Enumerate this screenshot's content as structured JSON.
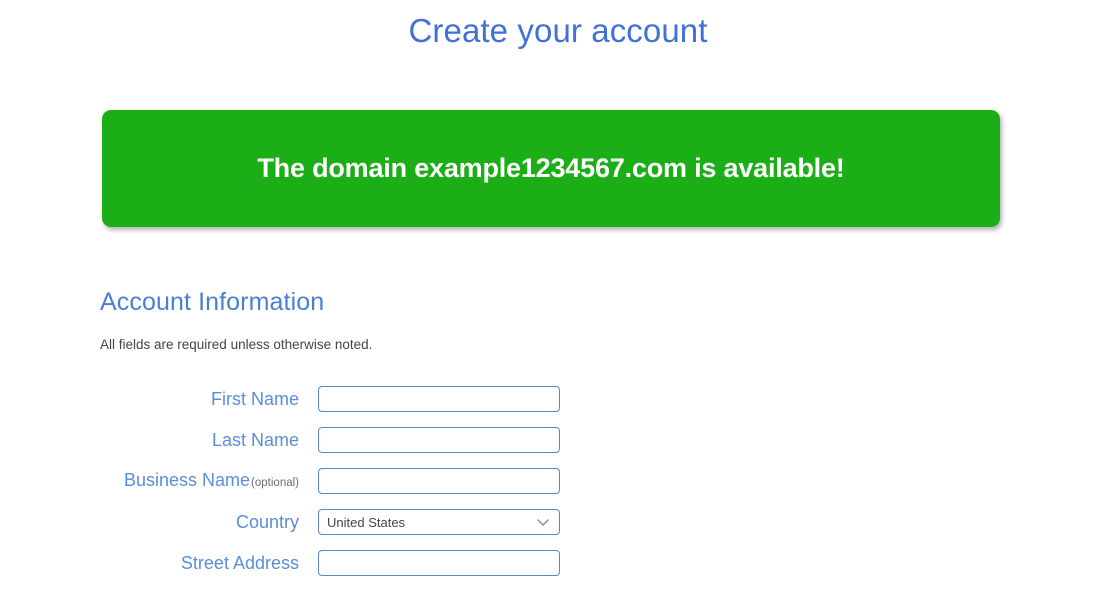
{
  "page": {
    "title": "Create your account",
    "title_color": "#3f71d7"
  },
  "banner": {
    "message": "The domain example1234567.com is available!",
    "background_color": "#1cae16",
    "text_color": "#ffffff"
  },
  "section": {
    "heading": "Account Information",
    "note": "All fields are required unless otherwise noted.",
    "heading_color": "#4a7fd4"
  },
  "form": {
    "label_color": "#5b8dd9",
    "input_border_color": "#5b87c8",
    "fields": [
      {
        "label": "First Name",
        "optional_tag": "",
        "type": "text",
        "value": "",
        "placeholder": ""
      },
      {
        "label": "Last Name",
        "optional_tag": "",
        "type": "text",
        "value": "",
        "placeholder": ""
      },
      {
        "label": "Business Name",
        "optional_tag": "(optional)",
        "type": "text",
        "value": "",
        "placeholder": ""
      },
      {
        "label": "Country",
        "optional_tag": "",
        "type": "select",
        "value": "United States",
        "icon": "chevron-down-icon"
      },
      {
        "label": "Street Address",
        "optional_tag": "",
        "type": "text",
        "value": "",
        "placeholder": ""
      }
    ]
  }
}
